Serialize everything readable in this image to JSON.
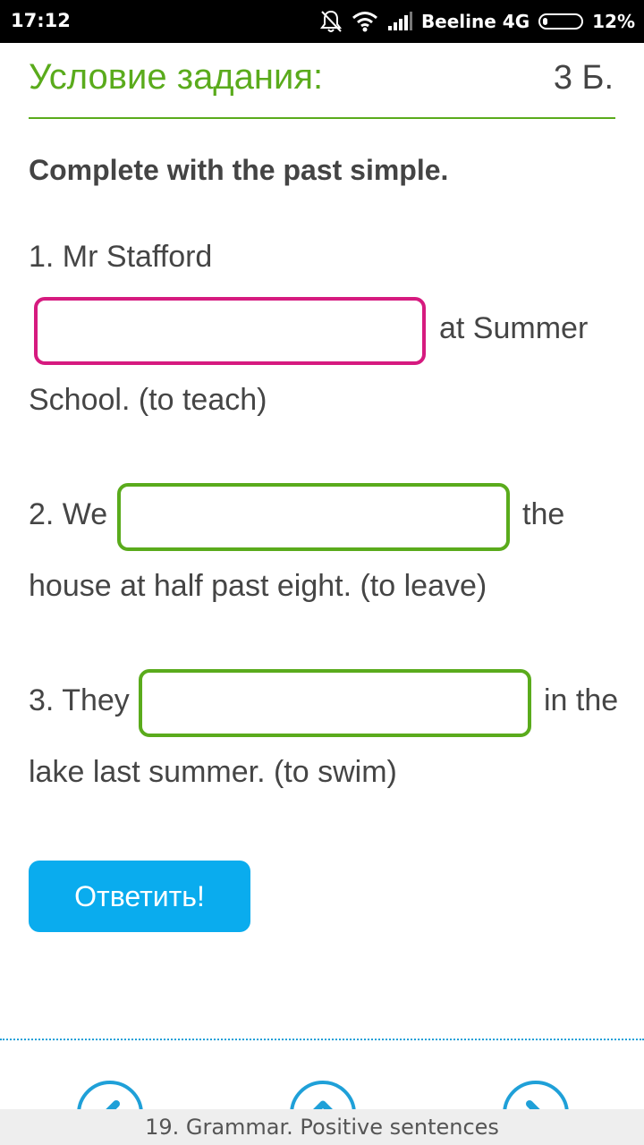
{
  "status_bar": {
    "time": "17:12",
    "carrier": "Beeline 4G",
    "battery": "12%",
    "battery_level": 0.12,
    "icons": [
      "muted-bell-icon",
      "wifi-icon",
      "signal-icon",
      "battery-icon"
    ]
  },
  "header": {
    "title": "Условие задания:",
    "points": "3 Б."
  },
  "exercise": {
    "instruction": "Complete with the past simple.",
    "items": [
      {
        "prefix": "1. Mr Stafford",
        "input_value": "",
        "after": "at Summer",
        "tail": "School. (to teach)",
        "state": "active"
      },
      {
        "prefix": "2. We",
        "input_value": "",
        "after": "the",
        "tail": "house at half past eight. (to leave)",
        "state": "normal"
      },
      {
        "prefix": "3. They",
        "input_value": "",
        "after": "in the",
        "tail": "lake last summer. (to swim)",
        "state": "normal"
      }
    ]
  },
  "submit_button": {
    "label": "Ответить!"
  },
  "navigation": {
    "icons": [
      "prev-arrow-icon",
      "up-arrow-icon",
      "next-arrow-icon"
    ],
    "page_title": "19. Grammar. Positive sentences"
  },
  "colors": {
    "accent_green": "#5aab1c",
    "active_pink": "#d61a7f",
    "button_blue": "#0aacee",
    "nav_blue": "#1fa0d8"
  }
}
